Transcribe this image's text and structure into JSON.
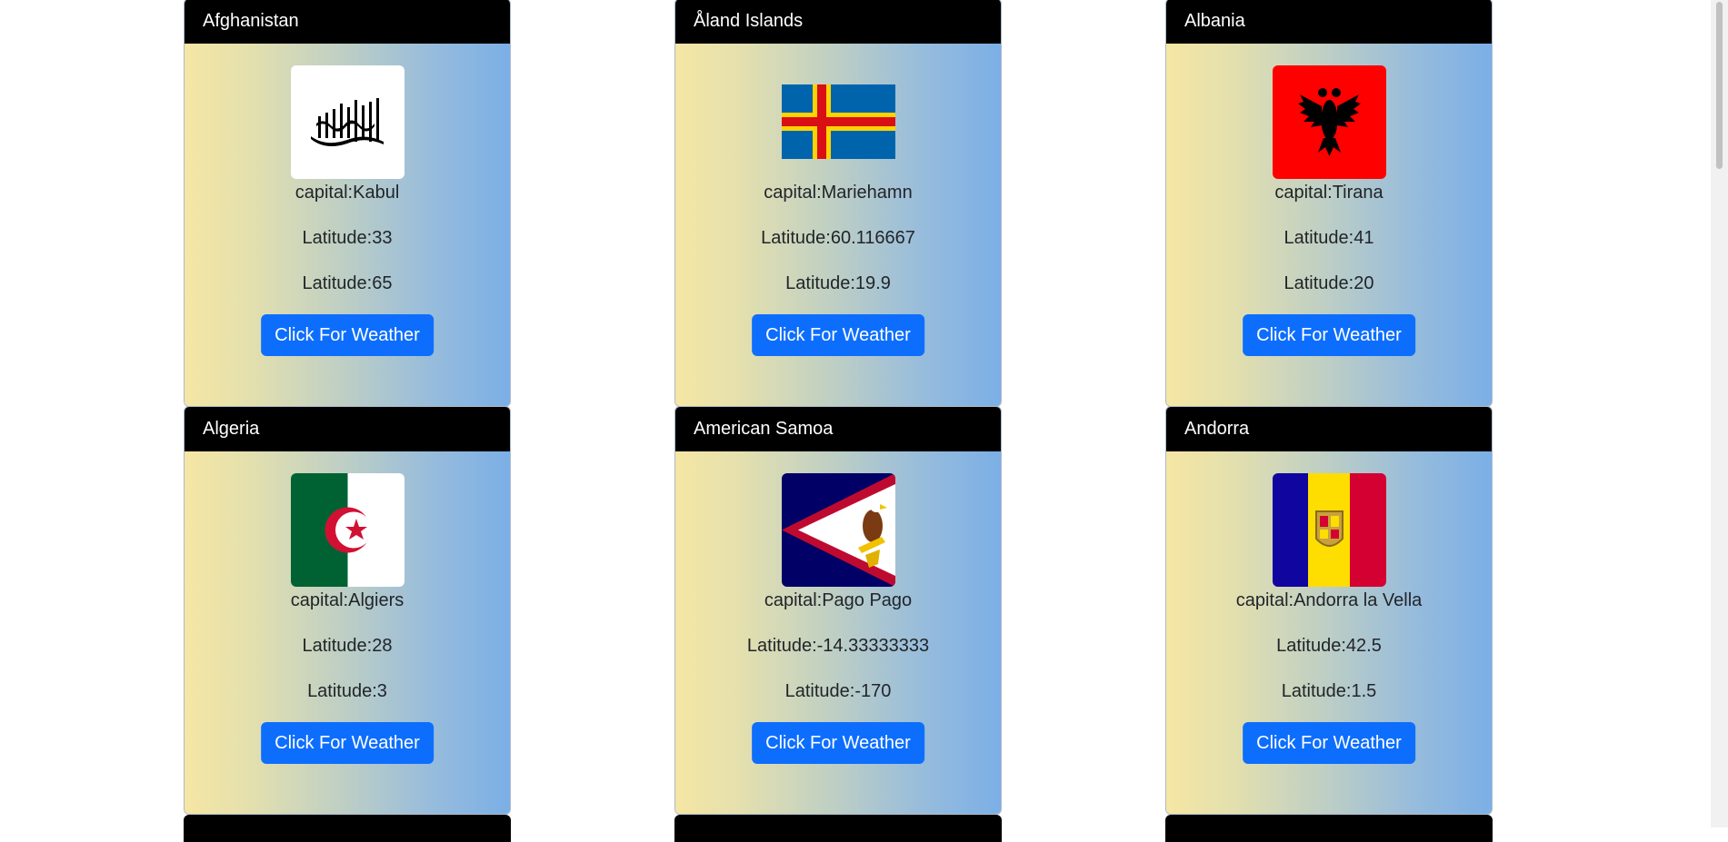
{
  "cards": [
    {
      "country": "Afghanistan",
      "capital": "capital:Kabul",
      "lat": "Latitude:33",
      "lng": "Latitude:65",
      "button": "Click For Weather",
      "flag_icon": "afghanistan-flag-icon"
    },
    {
      "country": "Åland Islands",
      "capital": "capital:Mariehamn",
      "lat": "Latitude:60.116667",
      "lng": "Latitude:19.9",
      "button": "Click For Weather",
      "flag_icon": "aland-islands-flag-icon"
    },
    {
      "country": "Albania",
      "capital": "capital:Tirana",
      "lat": "Latitude:41",
      "lng": "Latitude:20",
      "button": "Click For Weather",
      "flag_icon": "albania-flag-icon"
    },
    {
      "country": "Algeria",
      "capital": "capital:Algiers",
      "lat": "Latitude:28",
      "lng": "Latitude:3",
      "button": "Click For Weather",
      "flag_icon": "algeria-flag-icon"
    },
    {
      "country": "American Samoa",
      "capital": "capital:Pago Pago",
      "lat": "Latitude:-14.33333333",
      "lng": "Latitude:-170",
      "button": "Click For Weather",
      "flag_icon": "american-samoa-flag-icon"
    },
    {
      "country": "Andorra",
      "capital": "capital:Andorra la Vella",
      "lat": "Latitude:42.5",
      "lng": "Latitude:1.5",
      "button": "Click For Weather",
      "flag_icon": "andorra-flag-icon"
    }
  ],
  "colors": {
    "header_bg": "#000000",
    "button_bg": "#0d6efd",
    "gradient_start": "#f5e6a4",
    "gradient_end": "#7bafe6"
  }
}
